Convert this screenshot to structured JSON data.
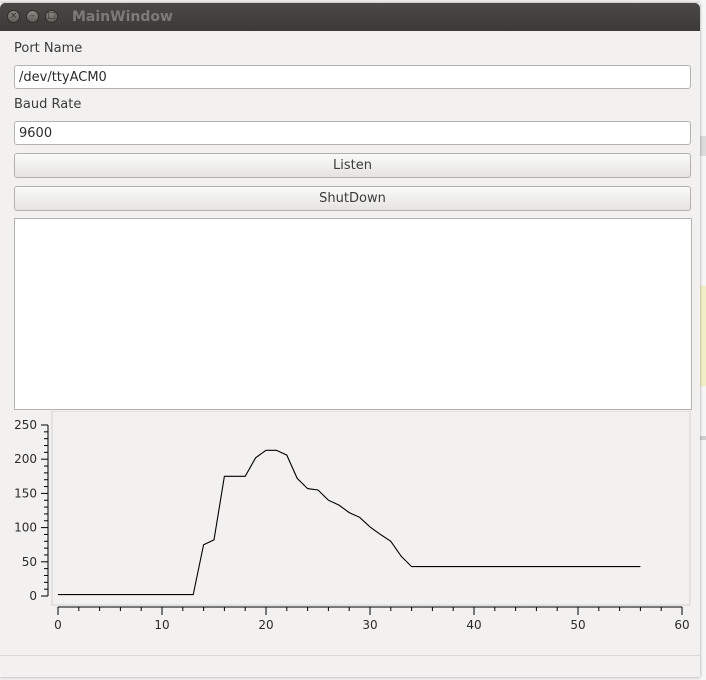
{
  "window": {
    "title": "MainWindow"
  },
  "titlebar_buttons": [
    {
      "name": "close-icon",
      "glyph": "×"
    },
    {
      "name": "minimize-icon",
      "glyph": "–"
    },
    {
      "name": "maximize-icon",
      "glyph": "□"
    }
  ],
  "form": {
    "port_label": "Port Name",
    "port_value": "/dev/ttyACM0",
    "baud_label": "Baud Rate",
    "baud_value": "9600",
    "listen_label": "Listen",
    "shutdown_label": "ShutDown"
  },
  "output_text": "",
  "chart_data": {
    "type": "line",
    "title": "",
    "xlabel": "",
    "ylabel": "",
    "xlim": [
      0,
      60
    ],
    "ylim": [
      0,
      250
    ],
    "x_ticks": [
      0,
      10,
      20,
      30,
      40,
      50,
      60
    ],
    "y_ticks": [
      0,
      50,
      100,
      150,
      200,
      250
    ],
    "grid": false,
    "series": [
      {
        "x": [
          0,
          13,
          14,
          15,
          16,
          17,
          18,
          19,
          20,
          21,
          22,
          23,
          24,
          25,
          26,
          27,
          28,
          29,
          30,
          31,
          32,
          33,
          34,
          35,
          36,
          56
        ],
        "y": [
          2,
          2,
          75,
          82,
          175,
          175,
          175,
          202,
          213,
          213,
          206,
          172,
          157,
          155,
          140,
          133,
          122,
          115,
          101,
          90,
          80,
          58,
          43,
          43,
          43,
          43
        ]
      }
    ],
    "line_color": "#000000",
    "background": "#f2f1f0"
  }
}
